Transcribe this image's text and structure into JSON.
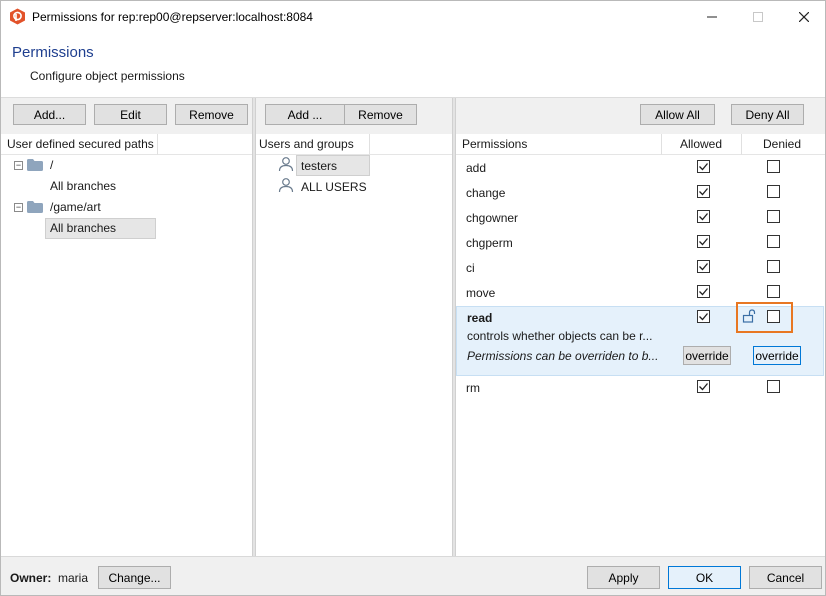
{
  "window": {
    "title": "Permissions for rep:rep00@repserver:localhost:8084",
    "min_glyph": "—",
    "max_glyph": "☐",
    "close_glyph": "✕",
    "icon": "app-logo-icon"
  },
  "header": {
    "title": "Permissions",
    "subtitle": "Configure object permissions"
  },
  "paths_panel": {
    "add_label": "Add...",
    "edit_label": "Edit",
    "remove_label": "Remove",
    "column_header": "User defined secured paths",
    "tree": [
      {
        "path": "/",
        "child": "All branches",
        "expanded": true,
        "selected": false
      },
      {
        "path": "/game/art",
        "child": "All branches",
        "expanded": true,
        "selected": true
      }
    ]
  },
  "users_panel": {
    "add_label": "Add ...",
    "remove_label": "Remove",
    "column_header": "Users and groups",
    "items": [
      {
        "name": "testers",
        "selected": true,
        "icon": "user-icon"
      },
      {
        "name": "ALL USERS",
        "selected": false,
        "icon": "user-icon"
      }
    ]
  },
  "permissions_panel": {
    "allow_all_label": "Allow All",
    "deny_all_label": "Deny All",
    "headers": {
      "permission": "Permissions",
      "allowed": "Allowed",
      "denied": "Denied"
    },
    "rows": [
      {
        "name": "add",
        "allowed": true,
        "denied": false
      },
      {
        "name": "change",
        "allowed": true,
        "denied": false
      },
      {
        "name": "chgowner",
        "allowed": true,
        "denied": false
      },
      {
        "name": "chgperm",
        "allowed": true,
        "denied": false
      },
      {
        "name": "ci",
        "allowed": true,
        "denied": false
      },
      {
        "name": "move",
        "allowed": true,
        "denied": false
      }
    ],
    "read_row": {
      "name": "read",
      "allowed": true,
      "denied": false,
      "description": "controls whether objects can be r...",
      "override_note": "Permissions can be overriden to b...",
      "override_allowed_label": "override",
      "override_denied_label": "override",
      "lock_icon": "unlock-icon",
      "highlight_color": "#e87722"
    },
    "last_row": {
      "name": "rm",
      "allowed": true,
      "denied": false
    }
  },
  "footer": {
    "owner_label": "Owner:",
    "owner_value": "maria",
    "change_label": "Change...",
    "apply_label": "Apply",
    "ok_label": "OK",
    "cancel_label": "Cancel"
  },
  "colors": {
    "accent": "#0078d7",
    "title_blue": "#1f3f8f",
    "selection": "#e5f1fb"
  }
}
